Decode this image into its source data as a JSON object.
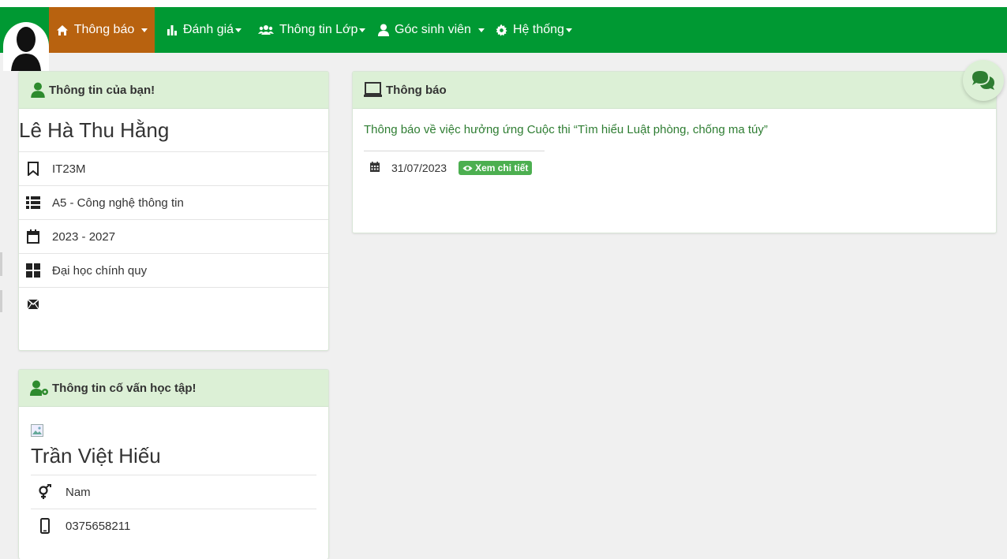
{
  "nav": {
    "items": [
      {
        "label": "Thông báo",
        "icon": "home-icon"
      },
      {
        "label": "Đánh giá",
        "icon": "bar-chart-icon"
      },
      {
        "label": "Thông tin Lớp",
        "icon": "users-icon"
      },
      {
        "label": "Góc sinh viên",
        "icon": "user-icon"
      },
      {
        "label": "Hệ thống",
        "icon": "gear-icon"
      }
    ]
  },
  "colors": {
    "navbar": "#009933",
    "active_tab": "#b8620f",
    "panel_header": "#dcf0d6",
    "badge": "#4caf50"
  },
  "student": {
    "panel_title": "Thông tin của bạn!",
    "name": "Lê Hà Thu Hằng",
    "class_code": "IT23M",
    "faculty": "A5 - Công nghệ thông tin",
    "years": "2023 - 2027",
    "program": "Đại học chính quy",
    "email": ""
  },
  "advisor": {
    "panel_title": "Thông tin cố vấn học tập!",
    "name": "Trần Việt Hiếu",
    "gender": "Nam",
    "phone": "0375658211"
  },
  "notices": {
    "panel_title": "Thông báo",
    "items": [
      {
        "title": "Thông báo về việc hưởng ứng Cuộc thi “Tìm hiểu Luật phòng, chống ma túy”",
        "date": "31/07/2023",
        "action_label": "Xem chi tiết"
      }
    ]
  }
}
